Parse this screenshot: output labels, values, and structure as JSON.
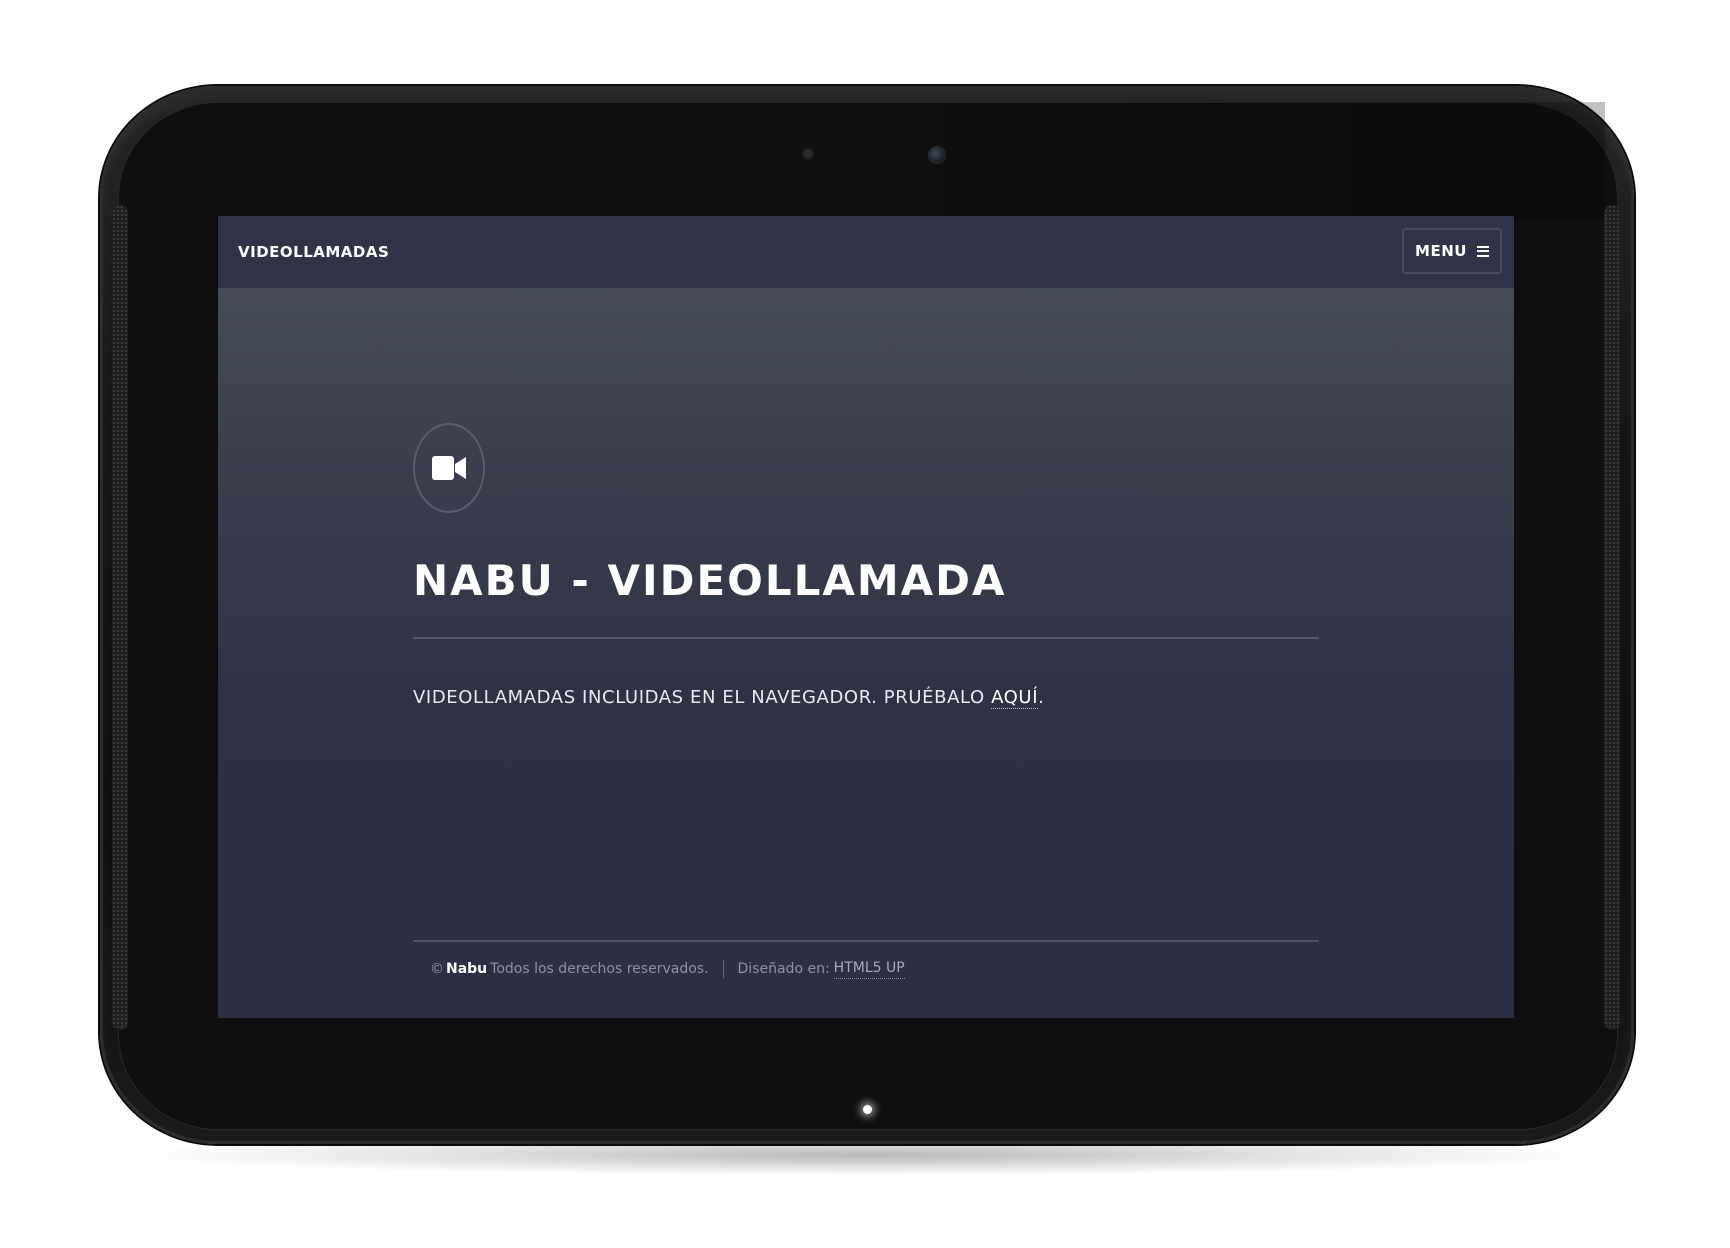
{
  "site": {
    "brand": "VIDEOLLAMADAS",
    "menu_label": "MENU"
  },
  "hero": {
    "icon": "video-camera-icon",
    "title": "NABU - VIDEOLLAMADA",
    "tagline_text": "VIDEOLLAMADAS INCLUIDAS EN EL NAVEGADOR. PRUÉBALO ",
    "tagline_link": "AQUÍ",
    "tagline_end": "."
  },
  "footer": {
    "copyright_symbol": "©",
    "owner": "Nabu",
    "rights": "Todos los derechos reservados.",
    "designed_label": "Diseñado en:",
    "designed_link": "HTML5 UP"
  },
  "colors": {
    "navbar_bg": "#303446",
    "screen_bg_top": "#4b505d",
    "screen_bg_bottom": "#2b2f41",
    "text_primary": "#ffffff",
    "text_muted": "#8f93a1",
    "device_frame": "#141414"
  }
}
